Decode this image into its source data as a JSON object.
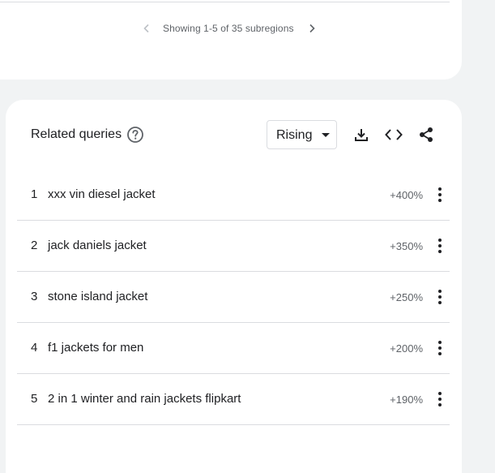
{
  "pager": {
    "text": "Showing 1-5 of 35 subregions",
    "prev_icon": "chevron-left-icon",
    "next_icon": "chevron-right-icon"
  },
  "related_queries": {
    "title": "Related queries",
    "help_icon": "help-circle-icon",
    "dropdown": {
      "selected": "Rising"
    },
    "tools": [
      "download-icon",
      "embed-code-icon",
      "share-icon"
    ],
    "rows": [
      {
        "index": "1",
        "label": "xxx vin diesel jacket",
        "value": "+400%"
      },
      {
        "index": "2",
        "label": "jack daniels jacket",
        "value": "+350%"
      },
      {
        "index": "3",
        "label": "stone island jacket",
        "value": "+250%"
      },
      {
        "index": "4",
        "label": "f1 jackets for men",
        "value": "+200%"
      },
      {
        "index": "5",
        "label": "2 in 1 winter and rain jackets flipkart",
        "value": "+190%"
      }
    ]
  },
  "colors": {
    "page_bg": "#f1f3f4",
    "card_bg": "#ffffff",
    "text_primary": "#202124",
    "text_secondary": "#5f6368",
    "divider": "#dadce0"
  }
}
